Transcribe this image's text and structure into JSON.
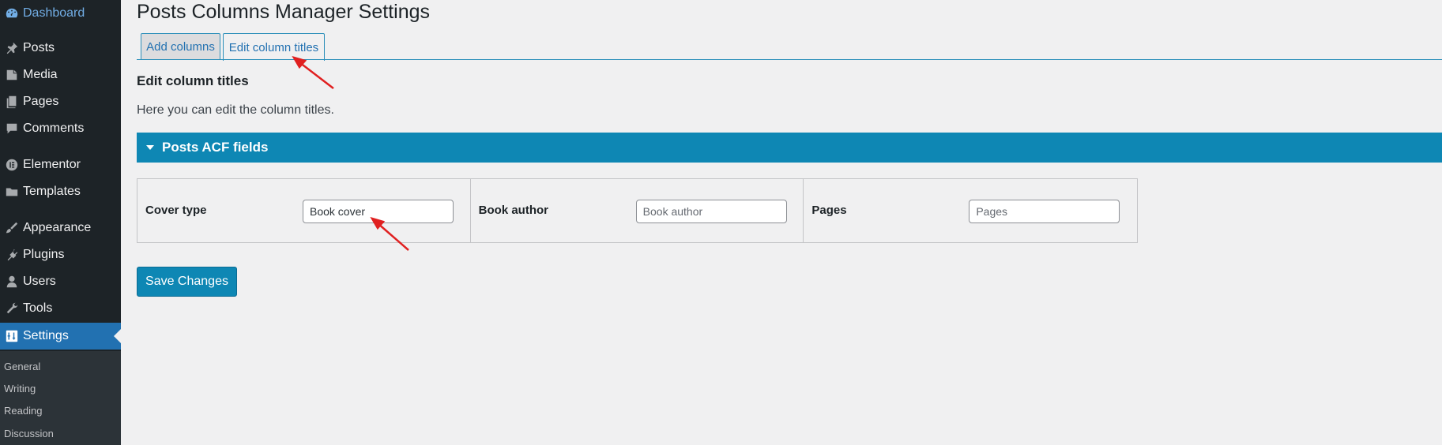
{
  "sidebar": {
    "items": [
      {
        "label": "Dashboard",
        "icon": "dashboard-icon"
      },
      {
        "label": "Posts",
        "icon": "pin-icon"
      },
      {
        "label": "Media",
        "icon": "media-icon"
      },
      {
        "label": "Pages",
        "icon": "pages-icon"
      },
      {
        "label": "Comments",
        "icon": "comment-icon"
      },
      {
        "label": "Elementor",
        "icon": "elementor-icon"
      },
      {
        "label": "Templates",
        "icon": "folder-icon"
      },
      {
        "label": "Appearance",
        "icon": "brush-icon"
      },
      {
        "label": "Plugins",
        "icon": "plug-icon"
      },
      {
        "label": "Users",
        "icon": "user-icon"
      },
      {
        "label": "Tools",
        "icon": "wrench-icon"
      },
      {
        "label": "Settings",
        "icon": "settings-icon"
      }
    ],
    "submenu": [
      "General",
      "Writing",
      "Reading",
      "Discussion"
    ]
  },
  "page": {
    "title": "Posts Columns Manager Settings",
    "tabs": [
      {
        "label": "Add columns",
        "active": false
      },
      {
        "label": "Edit column titles",
        "active": true
      }
    ],
    "section_title": "Edit column titles",
    "section_desc": "Here you can edit the column titles.",
    "acf_bar_title": "Posts ACF fields",
    "fields": [
      {
        "label": "Cover type",
        "value": "Book cover",
        "placeholder": ""
      },
      {
        "label": "Book author",
        "value": "",
        "placeholder": "Book author"
      },
      {
        "label": "Pages",
        "value": "",
        "placeholder": "Pages"
      }
    ],
    "save_label": "Save Changes"
  },
  "colors": {
    "sidebar_bg": "#1d2327",
    "active_menu": "#2271b1",
    "accent_bar": "#0e87b4",
    "annotation": "#e02020"
  }
}
